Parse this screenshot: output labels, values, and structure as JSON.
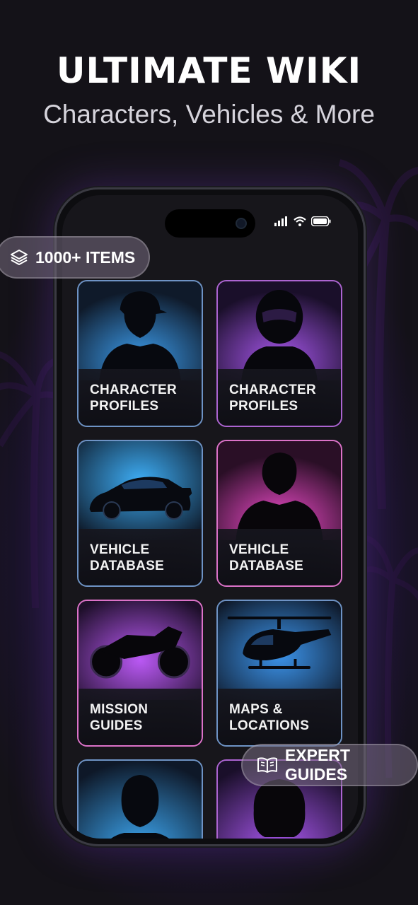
{
  "header": {
    "title": "ULTIMATE WIKI",
    "subtitle": "Characters, Vehicles & More"
  },
  "badges": {
    "items_count": "1000+ ITEMS",
    "expert_guides": "EXPERT GUIDES"
  },
  "status_bar": {
    "icons": [
      "signal-icon",
      "wifi-icon",
      "battery-icon"
    ]
  },
  "cards": [
    {
      "label": "CHARACTER\nPROFILES",
      "image": "man-in-cap-silhouette",
      "accent": "#3fa8ff"
    },
    {
      "label": "CHARACTER\nPROFILES",
      "image": "helmet-rider-silhouette",
      "accent": "#b45cff"
    },
    {
      "label": "VEHICLE\nDATABASE",
      "image": "sports-car-silhouette",
      "accent": "#3fb4ff"
    },
    {
      "label": "VEHICLE\nDATABASE",
      "image": "hooded-man-silhouette",
      "accent": "#ff4fd8"
    },
    {
      "label": "MISSION\nGUIDES",
      "image": "motorcycle-silhouette",
      "accent": "#c25cff"
    },
    {
      "label": "MAPS &\nLOCATIONS",
      "image": "helicopter-silhouette",
      "accent": "#3fa0ff"
    },
    {
      "label": "",
      "image": "man-silhouette",
      "accent": "#3fb0ff"
    },
    {
      "label": "",
      "image": "woman-silhouette",
      "accent": "#b45cff"
    }
  ],
  "colors": {
    "background": "#141218",
    "glow_purple": "#5a2b9a",
    "accent_blue": "#3fa8ff",
    "accent_purple": "#b45cff",
    "accent_pink": "#ff4fd8"
  }
}
